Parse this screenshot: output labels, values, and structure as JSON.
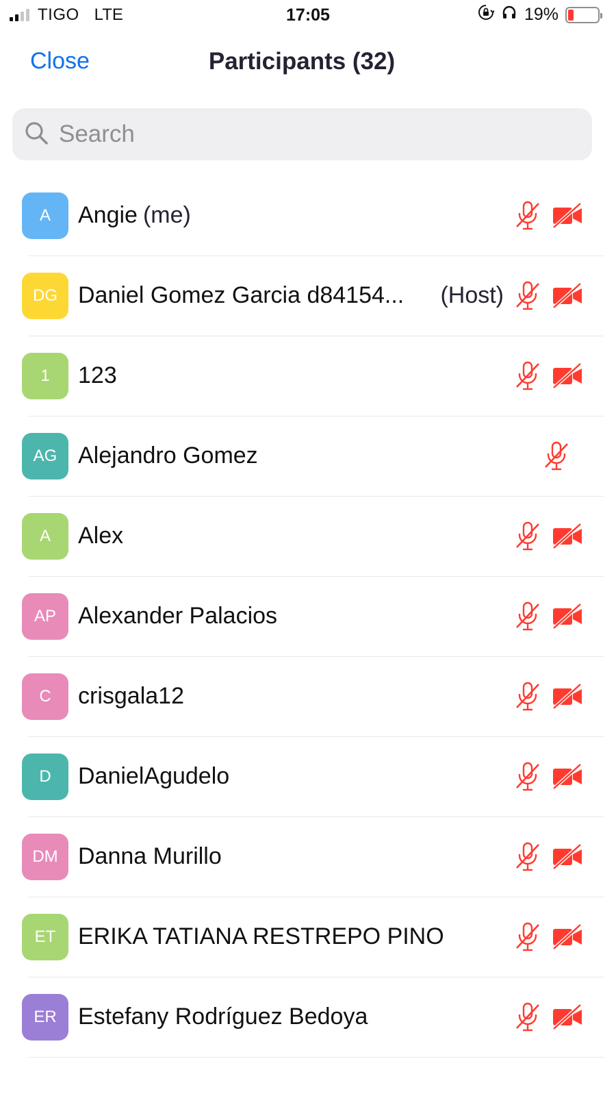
{
  "status_bar": {
    "carrier": "TIGO",
    "network": "LTE",
    "time": "17:05",
    "battery": "19%",
    "signal_bars": 2
  },
  "nav": {
    "close": "Close",
    "title": "Participants (32)"
  },
  "search": {
    "placeholder": "Search"
  },
  "colors": {
    "accent": "#0e72ed",
    "muted_icon": "#ff3b30",
    "avatar_blue": "#64b5f6",
    "avatar_yellow": "#fdd835",
    "avatar_green": "#a8d672",
    "avatar_teal": "#4db6ac",
    "avatar_pink": "#e88bb9",
    "avatar_purple": "#9b7ed6"
  },
  "participants": [
    {
      "initials": "A",
      "name": "Angie",
      "suffix": "(me)",
      "host": "",
      "color": "#64b5f6",
      "mic_muted": true,
      "video_off": true
    },
    {
      "initials": "DG",
      "name": "Daniel Gomez Garcia d84154...",
      "suffix": "",
      "host": "(Host)",
      "color": "#fdd835",
      "mic_muted": true,
      "video_off": true
    },
    {
      "initials": "1",
      "name": "123",
      "suffix": "",
      "host": "",
      "color": "#a8d672",
      "mic_muted": true,
      "video_off": true
    },
    {
      "initials": "AG",
      "name": "Alejandro Gomez",
      "suffix": "",
      "host": "",
      "color": "#4db6ac",
      "mic_muted": true,
      "video_off": false
    },
    {
      "initials": "A",
      "name": "Alex",
      "suffix": "",
      "host": "",
      "color": "#a8d672",
      "mic_muted": true,
      "video_off": true
    },
    {
      "initials": "AP",
      "name": "Alexander Palacios",
      "suffix": "",
      "host": "",
      "color": "#e88bb9",
      "mic_muted": true,
      "video_off": true
    },
    {
      "initials": "C",
      "name": "crisgala12",
      "suffix": "",
      "host": "",
      "color": "#e88bb9",
      "mic_muted": true,
      "video_off": true
    },
    {
      "initials": "D",
      "name": "DanielAgudelo",
      "suffix": "",
      "host": "",
      "color": "#4db6ac",
      "mic_muted": true,
      "video_off": true
    },
    {
      "initials": "DM",
      "name": "Danna Murillo",
      "suffix": "",
      "host": "",
      "color": "#e88bb9",
      "mic_muted": true,
      "video_off": true
    },
    {
      "initials": "ET",
      "name": "ERIKA TATIANA RESTREPO PINO",
      "suffix": "",
      "host": "",
      "color": "#a8d672",
      "mic_muted": true,
      "video_off": true
    },
    {
      "initials": "ER",
      "name": "Estefany Rodríguez Bedoya",
      "suffix": "",
      "host": "",
      "color": "#9b7ed6",
      "mic_muted": true,
      "video_off": true
    }
  ]
}
